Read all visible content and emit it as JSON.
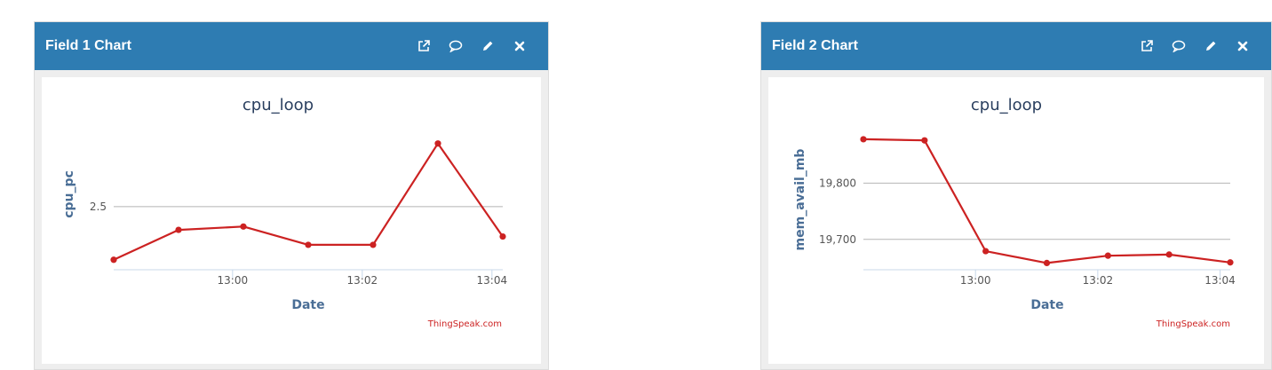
{
  "colors": {
    "header": "#2e7cb2",
    "line": "#cc2222",
    "grid": "#b5b5b5",
    "axis": "#c8d8ea",
    "credit": "#cc2222"
  },
  "panels": [
    {
      "title": "Field 1 Chart",
      "icons": [
        "external-link-icon",
        "comment-icon",
        "pencil-icon",
        "close-icon"
      ],
      "credit": "ThingSpeak.com"
    },
    {
      "title": "Field 2 Chart",
      "icons": [
        "external-link-icon",
        "comment-icon",
        "pencil-icon",
        "close-icon"
      ],
      "credit": "ThingSpeak.com"
    }
  ],
  "chart_data": [
    {
      "type": "line",
      "title": "cpu_loop",
      "xlabel": "Date",
      "ylabel": "cpu_pc",
      "x": [
        "12:58:10",
        "12:59:10",
        "13:00:10",
        "13:01:10",
        "13:02:10",
        "13:03:10",
        "13:04:10"
      ],
      "series": [
        {
          "values": [
            0.9,
            1.8,
            1.9,
            1.35,
            1.35,
            4.4,
            1.6
          ]
        }
      ],
      "xlim": [
        "12:58:10",
        "13:04:10"
      ],
      "ylim": [
        0.6,
        4.9
      ],
      "xticks": [
        "13:00",
        "13:02",
        "13:04"
      ],
      "yticks": [
        "2.5"
      ],
      "ytick_values": [
        2.5
      ],
      "grid": true,
      "legend": "none"
    },
    {
      "type": "line",
      "title": "cpu_loop",
      "xlabel": "Date",
      "ylabel": "mem_avail_mb",
      "x": [
        "12:58:10",
        "12:59:10",
        "13:00:10",
        "13:01:10",
        "13:02:10",
        "13:03:10",
        "13:04:10"
      ],
      "series": [
        {
          "values": [
            19878,
            19876,
            19679,
            19658,
            19671,
            19673,
            19659
          ]
        }
      ],
      "xlim": [
        "12:58:10",
        "13:04:10"
      ],
      "ylim": [
        19646,
        19900
      ],
      "xticks": [
        "13:00",
        "13:02",
        "13:04"
      ],
      "yticks": [
        "19,800",
        "19,700"
      ],
      "ytick_values": [
        19800,
        19700
      ],
      "grid": true,
      "legend": "none"
    }
  ]
}
